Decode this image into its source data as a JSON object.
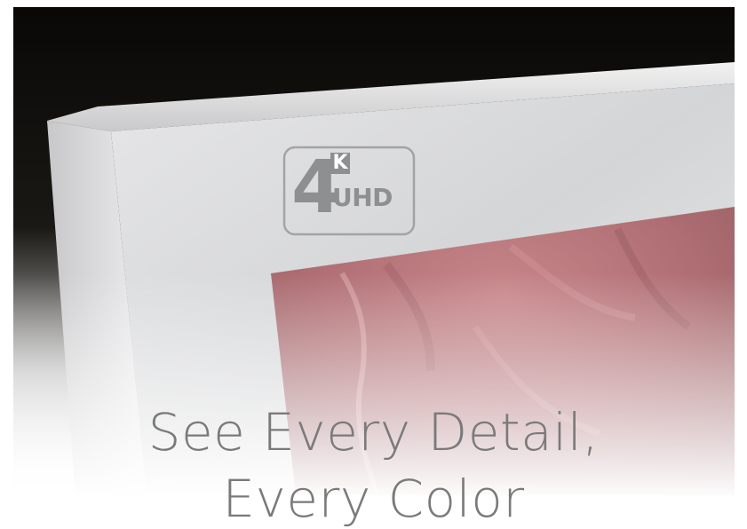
{
  "badge": {
    "digit": "4",
    "letter": "K",
    "label": "UHD"
  },
  "headline": {
    "line1": "See Every Detail,",
    "line2": "Every Color"
  },
  "colors": {
    "bezel": "#d9d9db",
    "screen_tissue": "#b9757a",
    "background": "#0c0b09",
    "text": "#7a7a7a"
  }
}
